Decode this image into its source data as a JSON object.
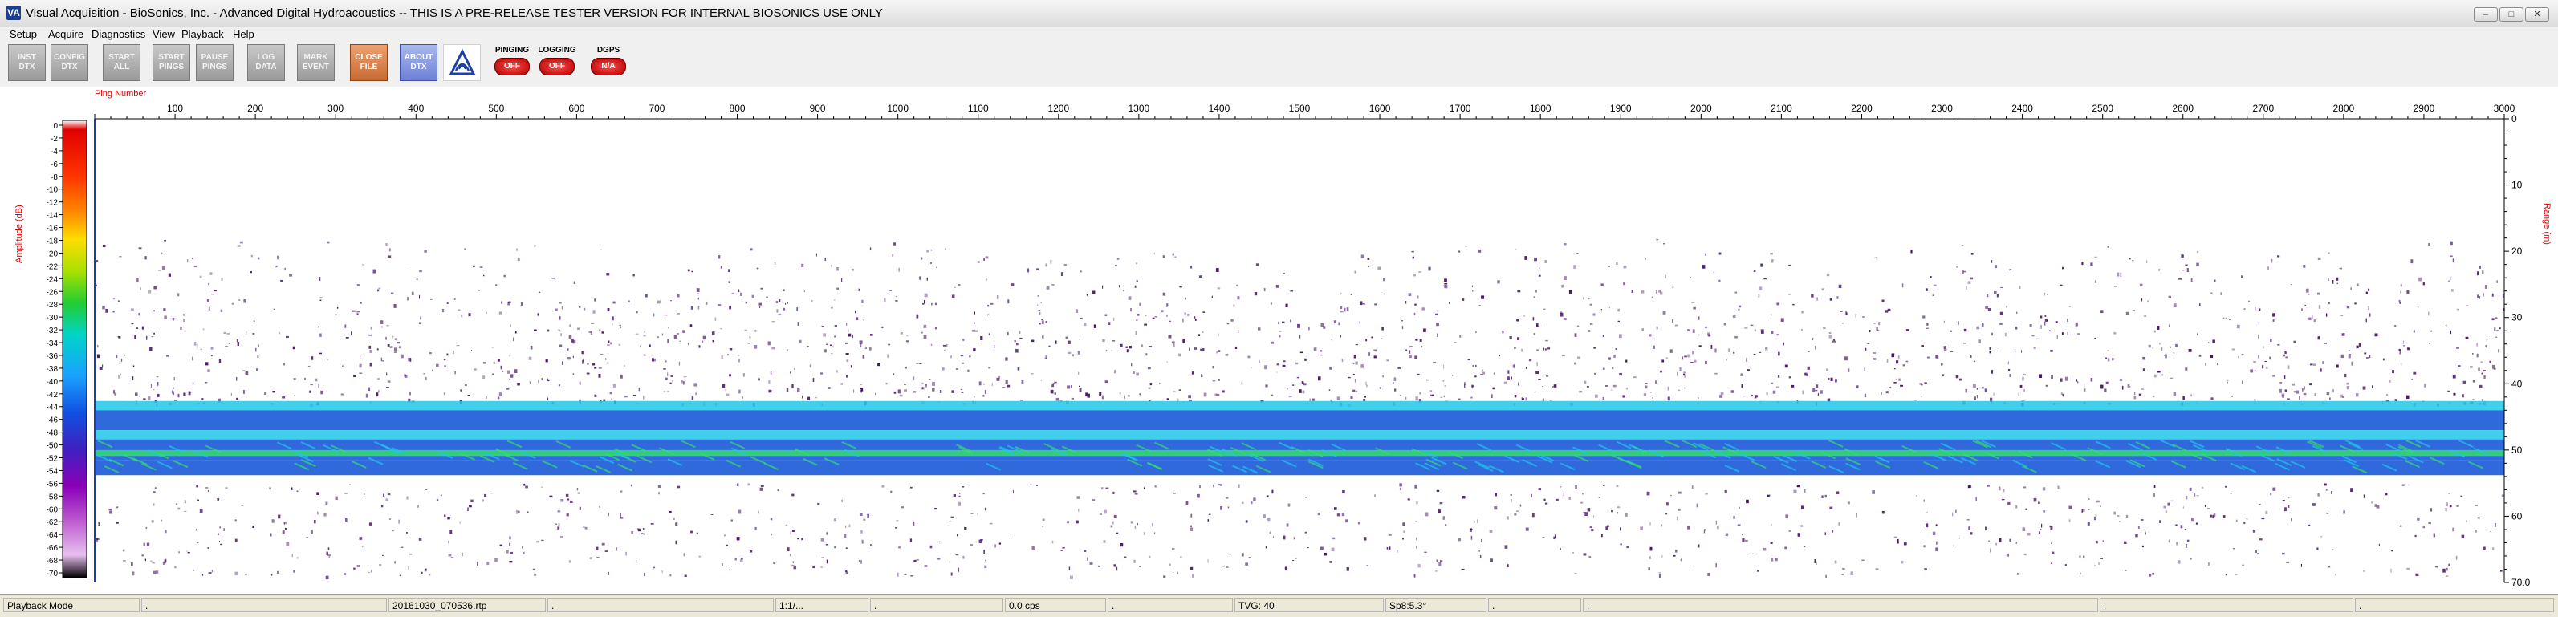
{
  "window": {
    "title": "Visual Acquisition  -  BioSonics, Inc.  -  Advanced Digital Hydroacoustics  -- THIS IS A PRE-RELEASE TESTER VERSION FOR INTERNAL BIOSONICS USE ONLY",
    "app_icon": "VA",
    "minimize_glyph": "–",
    "maximize_glyph": "□",
    "close_glyph": "✕"
  },
  "menu": [
    "Setup",
    "Acquire",
    "Diagnostics",
    "View",
    "Playback",
    "Help"
  ],
  "toolbar": {
    "buttons": [
      {
        "name": "inst-dtx-button",
        "label": "INST\nDTX",
        "style": "gray"
      },
      {
        "name": "config-dtx-button",
        "label": "CONFIG\nDTX",
        "style": "gray"
      },
      {
        "name": "start-all-button",
        "label": "START\nALL",
        "style": "gray"
      },
      {
        "name": "start-pings-button",
        "label": "START\nPINGS",
        "style": "gray"
      },
      {
        "name": "pause-pings-button",
        "label": "PAUSE\nPINGS",
        "style": "gray"
      },
      {
        "name": "log-data-button",
        "label": "LOG\nDATA",
        "style": "gray"
      },
      {
        "name": "mark-event-button",
        "label": "MARK\nEVENT",
        "style": "gray"
      },
      {
        "name": "close-file-button",
        "label": "CLOSE\nFILE",
        "style": "orange"
      },
      {
        "name": "about-dtx-button",
        "label": "ABOUT\nDTX",
        "style": "blue"
      }
    ],
    "logo_icon": "biosonics-logo-icon",
    "status": [
      {
        "label": "PINGING",
        "value": "OFF"
      },
      {
        "label": "LOGGING",
        "value": "OFF"
      },
      {
        "label": "DGPS",
        "value": "N/A"
      }
    ]
  },
  "echogram": {
    "x_axis_label": "Ping Number",
    "y_left_label": "Amplitude (dB)",
    "y_right_label": "Range (m)",
    "ping_ticks": [
      100,
      200,
      300,
      400,
      500,
      600,
      700,
      800,
      900,
      1000,
      1100,
      1200,
      1300,
      1400,
      1500,
      1600,
      1700,
      1800,
      1900,
      2000,
      2100,
      2200,
      2300,
      2400,
      2500,
      2600,
      2700,
      2800,
      2900,
      3000
    ],
    "ping_range": [
      0,
      3000
    ],
    "range_ticks": [
      "0",
      "10",
      "20",
      "30",
      "40",
      "50",
      "60",
      "70.0"
    ],
    "range_max": 70,
    "amp_ticks": [
      "0",
      "-2",
      "-4",
      "-6",
      "-8",
      "-10",
      "-12",
      "-14",
      "-16",
      "-18",
      "-20",
      "-22",
      "-24",
      "-26",
      "-28",
      "-30",
      "-32",
      "-34",
      "-36",
      "-38",
      "-40",
      "-42",
      "-44",
      "-46",
      "-48",
      "-50",
      "-52",
      "-54",
      "-56",
      "-58",
      "-60",
      "-62",
      "-64",
      "-66",
      "-68",
      "-70"
    ],
    "colors": {
      "scatter": "#3d0a5e",
      "band_blue": "#0a4fd6",
      "band_cyan": "#20c8e8",
      "band_green": "#33e06b",
      "axis_label": "#e00000"
    }
  },
  "statusbar": [
    "Playback Mode",
    ".",
    "20161030_070536.rtp",
    ".",
    "1:1/...",
    ".",
    "0.0 cps",
    ".",
    "TVG: 40",
    "Sp8:5.3°",
    ".",
    ".",
    ".",
    "."
  ]
}
